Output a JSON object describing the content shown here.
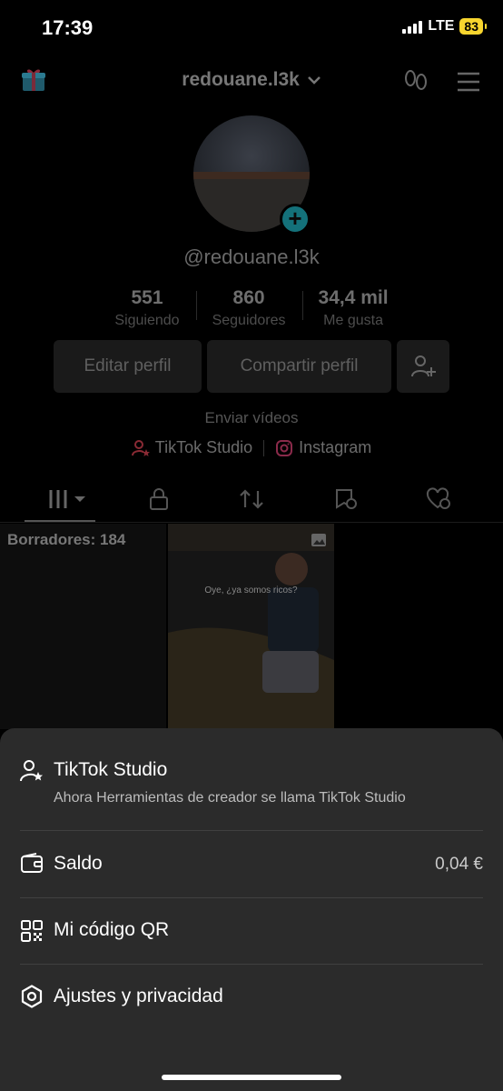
{
  "status_bar": {
    "time": "17:39",
    "network": "LTE",
    "battery": "83"
  },
  "profile": {
    "username": "redouane.l3k",
    "handle": "@redouane.l3k",
    "stats": [
      {
        "value": "551",
        "label": "Siguiendo"
      },
      {
        "value": "860",
        "label": "Seguidores"
      },
      {
        "value": "34,4 mil",
        "label": "Me gusta"
      }
    ],
    "buttons": {
      "edit": "Editar perfil",
      "share": "Compartir perfil"
    },
    "send_videos": "Enviar vídeos",
    "links": {
      "studio": "TikTok Studio",
      "instagram": "Instagram"
    },
    "drafts_label": "Borradores: 184",
    "video_caption": "Oye, ¿ya somos ricos?"
  },
  "sheet": {
    "studio": {
      "title": "TikTok Studio",
      "subtitle": "Ahora Herramientas de creador se llama TikTok Studio"
    },
    "balance": {
      "title": "Saldo",
      "value": "0,04 €"
    },
    "qr": {
      "title": "Mi código QR"
    },
    "settings": {
      "title": "Ajustes y privacidad"
    }
  },
  "colors": {
    "sheet_bg": "#2b2b2b",
    "accent_teal": "#14717a",
    "battery": "#f7d52e"
  }
}
